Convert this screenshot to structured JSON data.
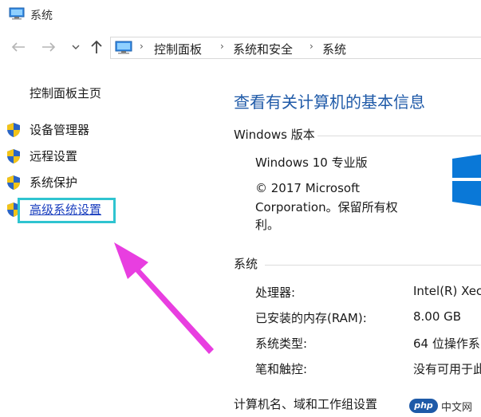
{
  "window": {
    "title": "系统",
    "app_icon": "computer-icon"
  },
  "navigation": {
    "back_icon": "arrow-left-icon",
    "forward_icon": "arrow-right-icon",
    "up_icon": "arrow-up-icon",
    "location_icon": "computer-icon",
    "breadcrumbs": [
      "控制面板",
      "系统和安全",
      "系统"
    ]
  },
  "sidebar": {
    "home_label": "控制面板主页",
    "items": [
      {
        "label": "设备管理器",
        "icon": "shield-icon"
      },
      {
        "label": "远程设置",
        "icon": "shield-icon"
      },
      {
        "label": "系统保护",
        "icon": "shield-icon"
      },
      {
        "label": "高级系统设置",
        "icon": "shield-icon",
        "highlighted": true
      }
    ]
  },
  "main": {
    "title": "查看有关计算机的基本信息",
    "edition_section": {
      "heading": "Windows 版本",
      "edition": "Windows 10 专业版",
      "copyright_line1": "© 2017 Microsoft",
      "copyright_line2": "Corporation。保留所有权",
      "copyright_line3": "利。"
    },
    "system_section": {
      "heading": "系统",
      "rows": [
        {
          "key": "处理器:",
          "value": "Intel(R) Xec"
        },
        {
          "key": "已安装的内存(RAM):",
          "value": "8.00 GB"
        },
        {
          "key": "系统类型:",
          "value": "64 位操作系"
        },
        {
          "key": "笔和触控:",
          "value": "没有可用于此"
        }
      ]
    },
    "computer_section": {
      "heading": "计算机名、域和工作组设置"
    }
  },
  "watermark": {
    "badge": "php",
    "text": "中文网"
  },
  "colors": {
    "title_blue": "#1f5aa8",
    "link_blue": "#1a3fbf",
    "highlight_cyan": "#2fc4d0",
    "arrow_magenta": "#e83ee0",
    "windows_blue": "#0a78d7"
  }
}
